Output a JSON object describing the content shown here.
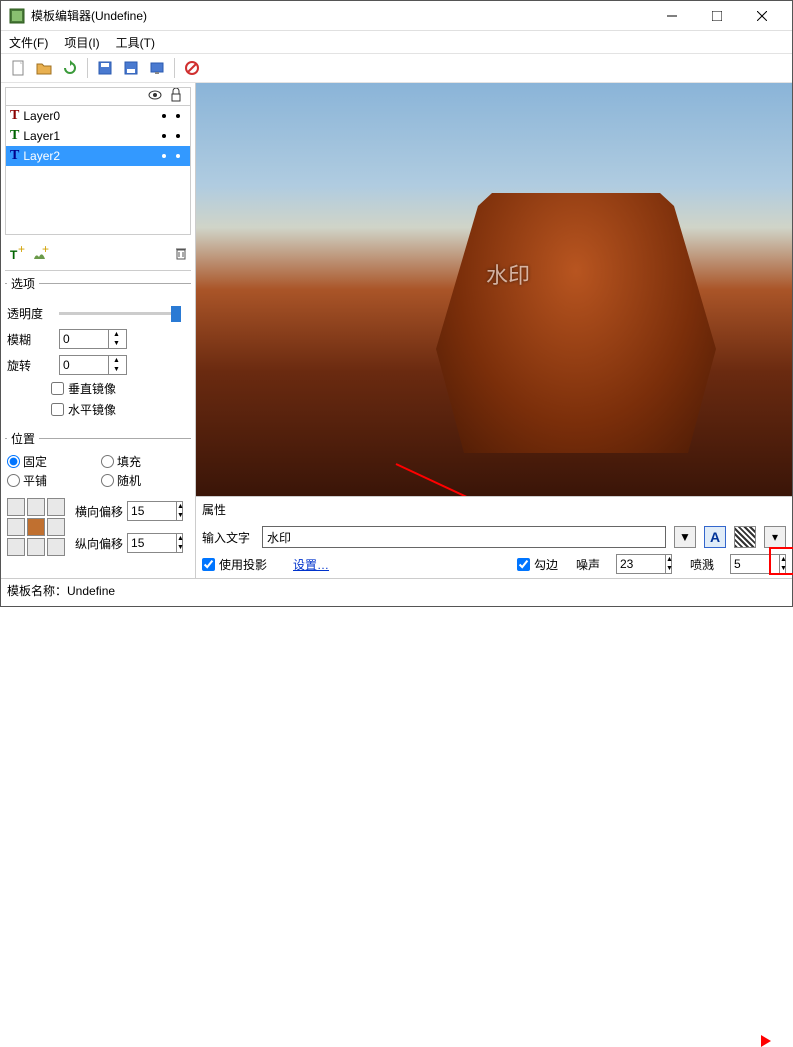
{
  "window": {
    "title": "模板编辑器(Undefine)"
  },
  "menu": {
    "file": "文件(F)",
    "project": "项目(I)",
    "tool": "工具(T)"
  },
  "layers": [
    {
      "name": "Layer0"
    },
    {
      "name": "Layer1"
    },
    {
      "name": "Layer2"
    }
  ],
  "options": {
    "legend": "选项",
    "opacity_label": "透明度",
    "blur_label": "模糊",
    "blur_value": "0",
    "rotate_label": "旋转",
    "rotate_value": "0",
    "vmirror": "垂直镜像",
    "hmirror": "水平镜像"
  },
  "position": {
    "legend": "位置",
    "fixed": "固定",
    "fill": "填充",
    "tile": "平铺",
    "random": "随机",
    "hoff_label": "横向偏移",
    "hoff_value": "15",
    "voff_label": "纵向偏移",
    "voff_value": "15"
  },
  "props": {
    "legend": "属性",
    "text_label": "输入文字",
    "text_value": "水印",
    "shadow": "使用投影",
    "settings": "设置…",
    "outline": "勾边",
    "noise_label": "噪声",
    "noise_value": "23",
    "spray_label": "喷溅",
    "spray_value": "5"
  },
  "watermark_preview": "水印",
  "status": {
    "label": "模板名称：",
    "value": "Undefine"
  }
}
